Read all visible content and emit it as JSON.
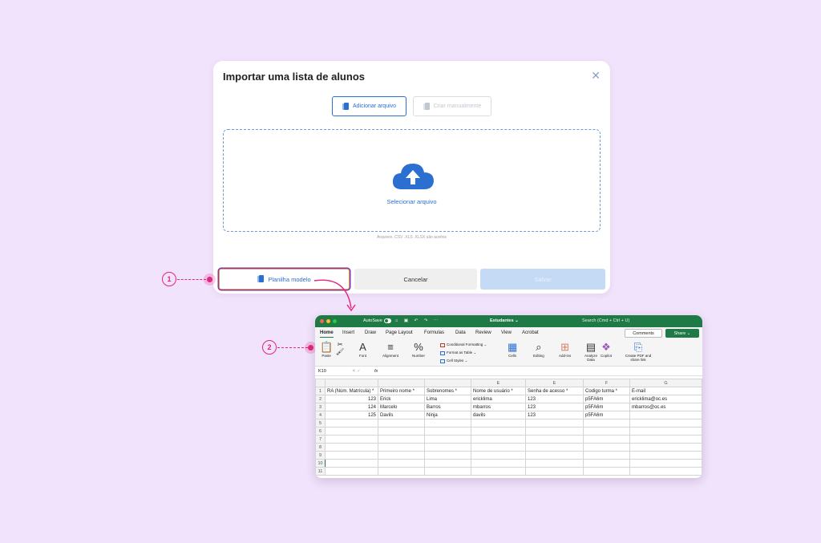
{
  "modal": {
    "title": "Importar uma lista de alunos",
    "close_label": "✕",
    "add_file_label": "Adicionar arquivo",
    "manual_label": "Criar manualmente",
    "drop_label": "Selecionar arquivo",
    "accepted_formats": "Arquivos .CSV .XLS .XLSX são aceitos",
    "template_label": "Planilha modelo",
    "cancel_label": "Cancelar",
    "save_label": "Salvar"
  },
  "callouts": [
    "1",
    "2"
  ],
  "colors": {
    "accent": "#2b6fd1",
    "callout": "#e3267e",
    "excel_green": "#1f7a45",
    "background": "#f1e3fb"
  },
  "excel": {
    "autosave_label": "AutoSave",
    "file_name": "Estudantes ⌄",
    "search_placeholder": "Search (Cmd + Ctrl + U)",
    "tabs": [
      "Home",
      "Insert",
      "Draw",
      "Page Layout",
      "Formulas",
      "Data",
      "Review",
      "View",
      "Acrobat"
    ],
    "comments_label": "Comments",
    "share_label": "Share ⌄",
    "ribbon": {
      "paste": "Paste",
      "font": "Font",
      "alignment": "Alignment",
      "number": "Number",
      "conditional_formatting": "Conditional Formatting ⌄",
      "format_as_table": "Format as Table ⌄",
      "cell_styles": "Cell Styles ⌄",
      "cells": "Cells",
      "editing": "Editing",
      "addins": "Add-ins",
      "analyze_data": "Analyze Data",
      "copilot": "Copilot",
      "create_pdf": "Create PDF and share link"
    },
    "cell_ref": "K10",
    "fx": "fx",
    "columns": [
      "",
      "",
      "",
      "E",
      "E",
      "F",
      "G"
    ],
    "rows": [
      [
        "RA (Núm. Matrícula) *",
        "Primeiro nome *",
        "Sobrenomes *",
        "Nome de usuário *",
        "Senha de acesso *",
        "Codigo turma *",
        "E-mail"
      ],
      [
        "123",
        "Erick",
        "Lima",
        "ericklima",
        "123",
        "p5FA6m",
        "ericklima@oc.es"
      ],
      [
        "124",
        "Marcelo",
        "Barros",
        "mbarros",
        "123",
        "p5FA6m",
        "mbarros@oc.es"
      ],
      [
        "125",
        "Davils",
        "Ninja",
        "davils",
        "123",
        "p5FA6m",
        ""
      ],
      [
        "",
        "",
        "",
        "",
        "",
        "",
        ""
      ],
      [
        "",
        "",
        "",
        "",
        "",
        "",
        ""
      ],
      [
        "",
        "",
        "",
        "",
        "",
        "",
        ""
      ],
      [
        "",
        "",
        "",
        "",
        "",
        "",
        ""
      ],
      [
        "",
        "",
        "",
        "",
        "",
        "",
        ""
      ],
      [
        "",
        "",
        "",
        "",
        "",
        "",
        ""
      ],
      [
        "",
        "",
        "",
        "",
        "",
        "",
        ""
      ]
    ],
    "row_numbers": [
      "1",
      "2",
      "3",
      "4",
      "5",
      "6",
      "7",
      "8",
      "9",
      "10",
      "11"
    ]
  }
}
